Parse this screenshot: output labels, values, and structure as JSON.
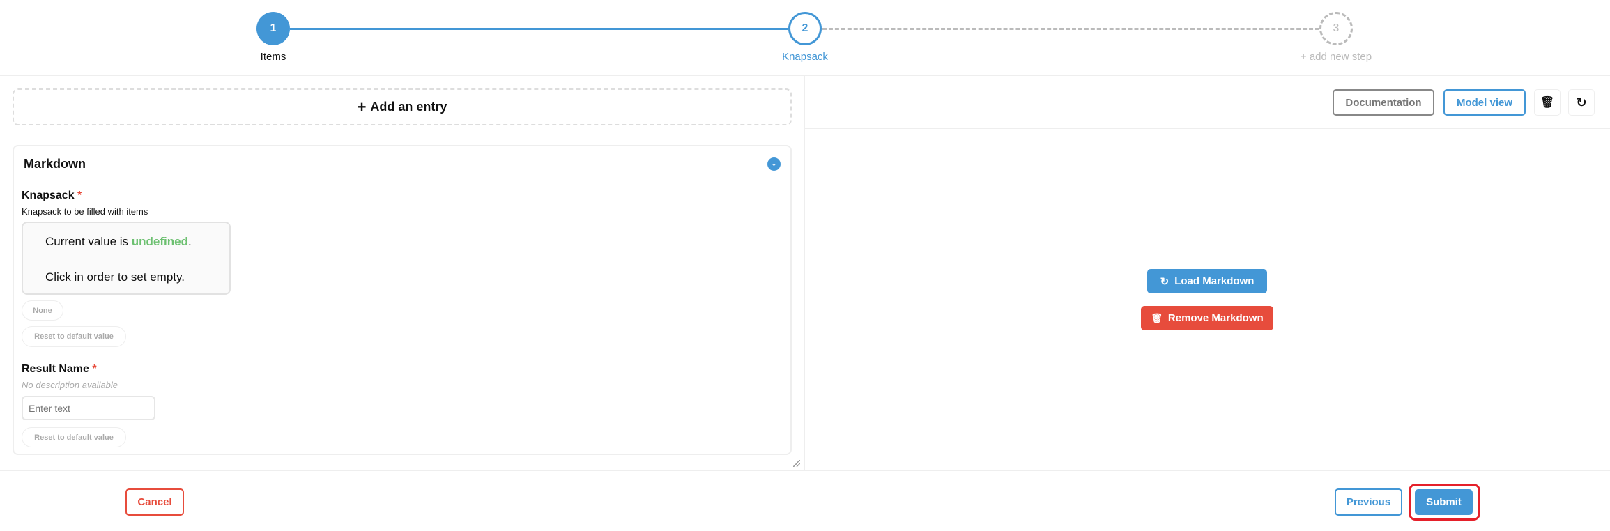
{
  "stepper": {
    "steps": [
      {
        "number": "1",
        "label": "Items",
        "state": "completed"
      },
      {
        "number": "2",
        "label": "Knapsack",
        "state": "active"
      },
      {
        "number": "3",
        "label": "+ add new step",
        "state": "placeholder"
      }
    ]
  },
  "left": {
    "add_entry": "Add an entry",
    "card": {
      "title": "Markdown",
      "fields": [
        {
          "label": "Knapsack",
          "required": "*",
          "description": "Knapsack to be filled with items",
          "value_prefix": "Current value is ",
          "value_word": "undefined",
          "value_suffix": ".",
          "hint": "Click in order to set empty.",
          "none_button": "None",
          "reset_button": "Reset to default value"
        },
        {
          "label": "Result Name",
          "required": "*",
          "description": "No description available",
          "placeholder": "Enter text",
          "value": "",
          "reset_button": "Reset to default value"
        }
      ]
    }
  },
  "right": {
    "documentation": "Documentation",
    "model_view": "Model view",
    "load_markdown": "Load Markdown",
    "remove_markdown": "Remove Markdown"
  },
  "footer": {
    "cancel": "Cancel",
    "previous": "Previous",
    "submit": "Submit"
  },
  "colors": {
    "primary": "#4397d6",
    "danger": "#e74c3c",
    "success": "#6cc070"
  }
}
